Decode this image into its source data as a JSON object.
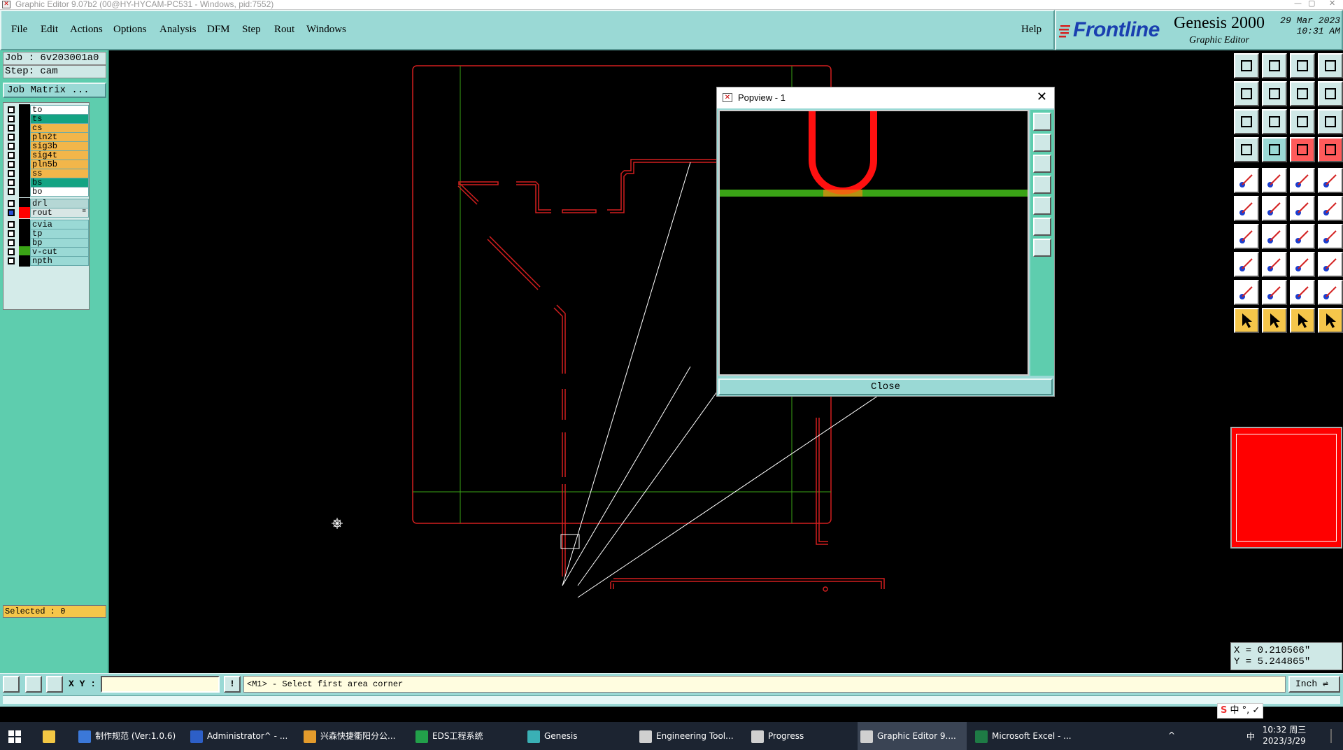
{
  "window": {
    "title": "Graphic Editor 9.07b2 (00@HY-HYCAM-PC531 - Windows, pid:7552)"
  },
  "menu": {
    "items": [
      "File",
      "Edit",
      "Actions",
      "Options",
      "Analysis",
      "DFM",
      "Step",
      "Rout",
      "Windows"
    ],
    "help": "Help"
  },
  "brand": {
    "logo": "Frontline",
    "product": "Genesis 2000",
    "subtitle": "Graphic Editor",
    "date": "29 Mar 2023",
    "time": "10:31 AM"
  },
  "job": {
    "job_label": "Job : 6v203001a0",
    "step_label": "Step: cam",
    "matrix_button": "Job Matrix ..."
  },
  "layers": [
    {
      "name": "to",
      "color": "#ffffff",
      "checked": false
    },
    {
      "name": "ts",
      "color": "#14a383",
      "checked": false
    },
    {
      "name": "cs",
      "color": "#f2b64a",
      "checked": false
    },
    {
      "name": "pln2t",
      "color": "#f2b64a",
      "checked": false
    },
    {
      "name": "sig3b",
      "color": "#f2b64a",
      "checked": false
    },
    {
      "name": "sig4t",
      "color": "#f2b64a",
      "checked": false
    },
    {
      "name": "pln5b",
      "color": "#f2b64a",
      "checked": false
    },
    {
      "name": "ss",
      "color": "#f2b64a",
      "checked": false
    },
    {
      "name": "bs",
      "color": "#14a383",
      "checked": false
    },
    {
      "name": "bo",
      "color": "#ffffff",
      "checked": false
    },
    {
      "name": "drl",
      "color": "#b5d7d5",
      "checked": false
    },
    {
      "name": "rout",
      "color": "#d8e6e5",
      "checked": true,
      "swatch": "#ff0000",
      "marker": "≡"
    },
    {
      "name": "cvia",
      "color": "#9ad9d5",
      "checked": false
    },
    {
      "name": "tp",
      "color": "#9ad9d5",
      "checked": false
    },
    {
      "name": "bp",
      "color": "#9ad9d5",
      "checked": false
    },
    {
      "name": "v-cut",
      "color": "#9ad9d5",
      "checked": false,
      "swatch": "#3aa316"
    },
    {
      "name": "npth",
      "color": "#9ad9d5",
      "checked": false
    }
  ],
  "selected": "Selected : 0",
  "popview": {
    "title": "Popview - 1",
    "close_button": "Close"
  },
  "coords": {
    "x": "X = 0.210566\"",
    "y": "Y = 5.244865\""
  },
  "command": {
    "xy_label": "X Y :",
    "xy_value": "",
    "bang": "!",
    "prompt": "<M1> - Select first area corner",
    "unit": "Inch"
  },
  "ime_text": "中 °, ✓",
  "taskbar": {
    "items": [
      {
        "label": "制作规范 (Ver:1.0.6)",
        "icon_color": "#3b78d8"
      },
      {
        "label": "Administrator^ - ...",
        "icon_color": "#2d5fc7"
      },
      {
        "label": "兴森快捷衢阳分公...",
        "icon_color": "#e39b2c"
      },
      {
        "label": "EDS工程系统",
        "icon_color": "#22a04a"
      },
      {
        "label": "Genesis",
        "icon_color": "#3ab0b5"
      },
      {
        "label": "Engineering Tool...",
        "icon_color": "#d0d0d0"
      },
      {
        "label": "Progress",
        "icon_color": "#d0d0d0"
      },
      {
        "label": "Graphic Editor 9....",
        "icon_color": "#d0d0d0"
      },
      {
        "label": "Microsoft Excel - ...",
        "icon_color": "#1e7b45"
      }
    ],
    "tray_lang": "中",
    "clock_time": "10:32 周三",
    "clock_date": "2023/3/29"
  }
}
